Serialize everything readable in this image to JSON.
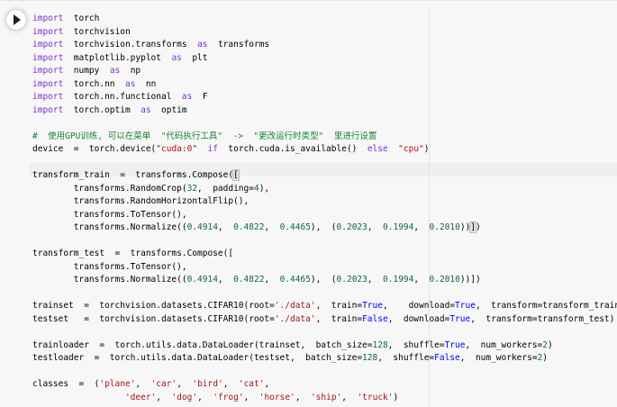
{
  "notebook": {
    "run_button": {
      "icon": "play-icon"
    },
    "lines": [
      [
        {
          "t": "import",
          "c": "k"
        },
        {
          "t": "  torch"
        }
      ],
      [
        {
          "t": "import",
          "c": "k"
        },
        {
          "t": "  torchvision"
        }
      ],
      [
        {
          "t": "import",
          "c": "k"
        },
        {
          "t": "  torchvision.transforms  "
        },
        {
          "t": "as",
          "c": "k"
        },
        {
          "t": "  transforms"
        }
      ],
      [
        {
          "t": "import",
          "c": "k"
        },
        {
          "t": "  matplotlib.pyplot  "
        },
        {
          "t": "as",
          "c": "k"
        },
        {
          "t": "  plt"
        }
      ],
      [
        {
          "t": "import",
          "c": "k"
        },
        {
          "t": "  numpy  "
        },
        {
          "t": "as",
          "c": "k"
        },
        {
          "t": "  np"
        }
      ],
      [
        {
          "t": "import",
          "c": "k"
        },
        {
          "t": "  torch.nn  "
        },
        {
          "t": "as",
          "c": "k"
        },
        {
          "t": "  nn"
        }
      ],
      [
        {
          "t": "import",
          "c": "k"
        },
        {
          "t": "  torch.nn.functional  "
        },
        {
          "t": "as",
          "c": "k"
        },
        {
          "t": "  F"
        }
      ],
      [
        {
          "t": "import",
          "c": "k"
        },
        {
          "t": "  torch.optim  "
        },
        {
          "t": "as",
          "c": "k"
        },
        {
          "t": "  optim"
        }
      ],
      [],
      [
        {
          "t": "#  使用GPU训练, 可以在菜单  \"代码执行工具\"  ->  \"更改运行时类型\"  里进行设置",
          "c": "c"
        }
      ],
      [
        {
          "t": "device  =  torch.device("
        },
        {
          "t": "\"cuda:0\"",
          "c": "s"
        },
        {
          "t": "  "
        },
        {
          "t": "if",
          "c": "k"
        },
        {
          "t": "  torch.cuda.is_available()  "
        },
        {
          "t": "else",
          "c": "k"
        },
        {
          "t": "  "
        },
        {
          "t": "\"cpu\"",
          "c": "s"
        },
        {
          "t": ")"
        }
      ],
      [],
      [
        {
          "t": "transform_train  =  transforms.Compose("
        },
        {
          "t": "[",
          "c": "hl"
        },
        {
          "t": "|",
          "c": "cursor"
        }
      ],
      [
        {
          "t": "        transforms.RandomCrop("
        },
        {
          "t": "32",
          "c": "n"
        },
        {
          "t": ",  padding="
        },
        {
          "t": "4",
          "c": "n"
        },
        {
          "t": "),"
        }
      ],
      [
        {
          "t": "        transforms.RandomHorizontalFlip(),"
        }
      ],
      [
        {
          "t": "        transforms.ToTensor(),"
        }
      ],
      [
        {
          "t": "        transforms.Normalize(("
        },
        {
          "t": "0.4914",
          "c": "n"
        },
        {
          "t": ",  "
        },
        {
          "t": "0.4822",
          "c": "n"
        },
        {
          "t": ",  "
        },
        {
          "t": "0.4465",
          "c": "n"
        },
        {
          "t": "),  ("
        },
        {
          "t": "0.2023",
          "c": "n"
        },
        {
          "t": ",  "
        },
        {
          "t": "0.1994",
          "c": "n"
        },
        {
          "t": ",  "
        },
        {
          "t": "0.2010",
          "c": "n"
        },
        {
          "t": "))"
        },
        {
          "t": "]",
          "c": "hl"
        },
        {
          "t": ")"
        }
      ],
      [],
      [
        {
          "t": "transform_test  =  transforms.Compose(["
        }
      ],
      [
        {
          "t": "        transforms.ToTensor(),"
        }
      ],
      [
        {
          "t": "        transforms.Normalize(("
        },
        {
          "t": "0.4914",
          "c": "n"
        },
        {
          "t": ",  "
        },
        {
          "t": "0.4822",
          "c": "n"
        },
        {
          "t": ",  "
        },
        {
          "t": "0.4465",
          "c": "n"
        },
        {
          "t": "),  ("
        },
        {
          "t": "0.2023",
          "c": "n"
        },
        {
          "t": ",  "
        },
        {
          "t": "0.1994",
          "c": "n"
        },
        {
          "t": ",  "
        },
        {
          "t": "0.2010",
          "c": "n"
        },
        {
          "t": "))])"
        }
      ],
      [],
      [
        {
          "t": "trainset  =  torchvision.datasets.CIFAR10(root="
        },
        {
          "t": "'./data'",
          "c": "s"
        },
        {
          "t": ",  train="
        },
        {
          "t": "True",
          "c": "b"
        },
        {
          "t": ",    download="
        },
        {
          "t": "True",
          "c": "b"
        },
        {
          "t": ",  transform=transform_train)"
        }
      ],
      [
        {
          "t": "testset   =  torchvision.datasets.CIFAR10(root="
        },
        {
          "t": "'./data'",
          "c": "s"
        },
        {
          "t": ",  train="
        },
        {
          "t": "False",
          "c": "b"
        },
        {
          "t": ",  download="
        },
        {
          "t": "True",
          "c": "b"
        },
        {
          "t": ",  transform=transform_test)"
        }
      ],
      [],
      [
        {
          "t": "trainloader  =  torch.utils.data.DataLoader(trainset,  batch_size="
        },
        {
          "t": "128",
          "c": "n"
        },
        {
          "t": ",  shuffle="
        },
        {
          "t": "True",
          "c": "b"
        },
        {
          "t": ",  num_workers="
        },
        {
          "t": "2",
          "c": "n"
        },
        {
          "t": ")"
        }
      ],
      [
        {
          "t": "testloader  =  torch.utils.data.DataLoader(testset,  batch_size="
        },
        {
          "t": "128",
          "c": "n"
        },
        {
          "t": ",  shuffle="
        },
        {
          "t": "False",
          "c": "b"
        },
        {
          "t": ",  num_workers="
        },
        {
          "t": "2",
          "c": "n"
        },
        {
          "t": ")"
        }
      ],
      [],
      [
        {
          "t": "classes  =  ("
        },
        {
          "t": "'plane'",
          "c": "s"
        },
        {
          "t": ",  "
        },
        {
          "t": "'car'",
          "c": "s"
        },
        {
          "t": ",  "
        },
        {
          "t": "'bird'",
          "c": "s"
        },
        {
          "t": ",  "
        },
        {
          "t": "'cat'",
          "c": "s"
        },
        {
          "t": ","
        }
      ],
      [
        {
          "t": "                  "
        },
        {
          "t": "'deer'",
          "c": "s"
        },
        {
          "t": ",  "
        },
        {
          "t": "'dog'",
          "c": "s"
        },
        {
          "t": ",  "
        },
        {
          "t": "'frog'",
          "c": "s"
        },
        {
          "t": ",  "
        },
        {
          "t": "'horse'",
          "c": "s"
        },
        {
          "t": ",  "
        },
        {
          "t": "'ship'",
          "c": "s"
        },
        {
          "t": ",  "
        },
        {
          "t": "'truck'",
          "c": "s"
        },
        {
          "t": ")"
        }
      ]
    ]
  }
}
